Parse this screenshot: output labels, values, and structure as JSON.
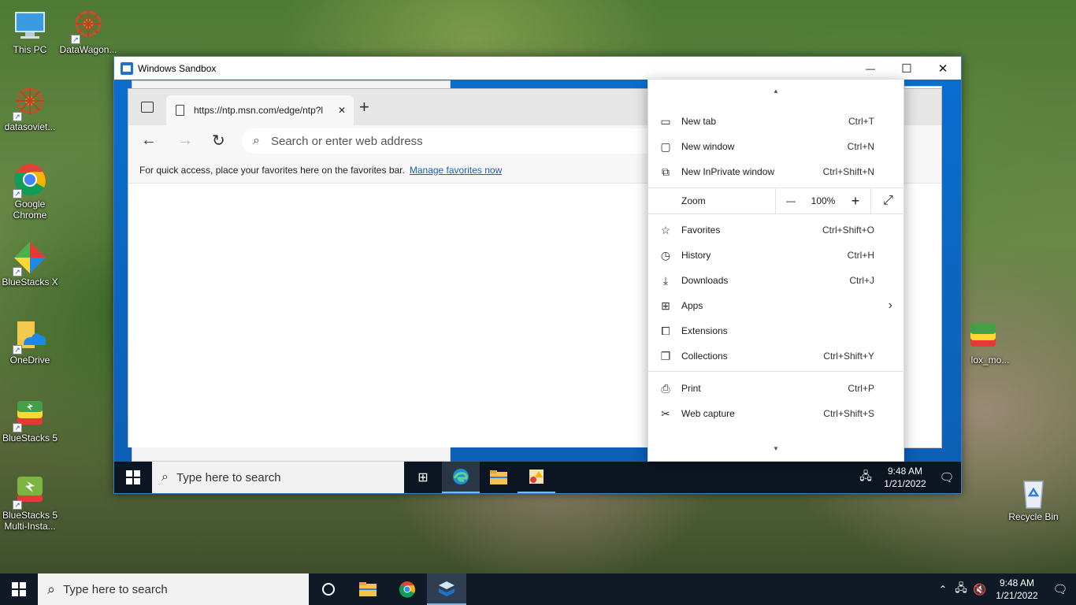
{
  "desktop": {
    "icons": [
      {
        "label": "This PC",
        "icon": "computer-icon"
      },
      {
        "label": "DataWagon...",
        "icon": "datawagon-icon"
      },
      {
        "label": "datasoviet...",
        "icon": "datasoviet-icon"
      },
      {
        "label": "Google Chrome",
        "icon": "chrome-icon"
      },
      {
        "label": "BlueStacks X",
        "icon": "bluestacks-x-icon"
      },
      {
        "label": "OneDrive",
        "icon": "onedrive-icon"
      },
      {
        "label": "BlueStacks 5",
        "icon": "bluestacks-icon"
      },
      {
        "label": "BlueStacks 5 Multi-Insta...",
        "icon": "bluestacks-multi-icon"
      },
      {
        "label": "Recycle Bin",
        "icon": "recycle-bin-icon"
      },
      {
        "label": "lox_mo...",
        "icon": "bluestacks-icon"
      }
    ]
  },
  "sandbox": {
    "title": "Windows Sandbox",
    "controls": {
      "minimize": "—",
      "maximize": "☐",
      "close": "✕"
    }
  },
  "edge": {
    "tab_title": "https://ntp.msn.com/edge/ntp?l",
    "new_tab_symbol": "+",
    "address_placeholder": "Search or enter web address",
    "favorites_hint": "For quick access, place your favorites here on the favorites bar.",
    "manage_favorites": "Manage favorites now",
    "more_button": "···",
    "close_x": "✕"
  },
  "menu": {
    "items": [
      {
        "label": "New tab",
        "shortcut": "Ctrl+T",
        "icon": "new-tab-icon"
      },
      {
        "label": "New window",
        "shortcut": "Ctrl+N",
        "icon": "new-window-icon"
      },
      {
        "label": "New InPrivate window",
        "shortcut": "Ctrl+Shift+N",
        "icon": "inprivate-icon"
      },
      {
        "label": "Favorites",
        "shortcut": "Ctrl+Shift+O",
        "icon": "favorites-icon"
      },
      {
        "label": "History",
        "shortcut": "Ctrl+H",
        "icon": "history-icon"
      },
      {
        "label": "Downloads",
        "shortcut": "Ctrl+J",
        "icon": "download-icon"
      },
      {
        "label": "Apps",
        "shortcut": "",
        "icon": "apps-icon"
      },
      {
        "label": "Extensions",
        "shortcut": "",
        "icon": "extensions-icon"
      },
      {
        "label": "Collections",
        "shortcut": "Ctrl+Shift+Y",
        "icon": "collections-icon"
      },
      {
        "label": "Print",
        "shortcut": "Ctrl+P",
        "icon": "print-icon"
      },
      {
        "label": "Web capture",
        "shortcut": "Ctrl+Shift+S",
        "icon": "web-capture-icon"
      }
    ],
    "zoom": {
      "label": "Zoom",
      "value": "100%",
      "minus": "—",
      "plus": "+"
    }
  },
  "inner_taskbar": {
    "search_placeholder": "Type here to search",
    "time": "9:48 AM",
    "date": "1/21/2022"
  },
  "taskbar": {
    "search_placeholder": "Type here to search",
    "time": "9:48 AM",
    "date": "1/21/2022"
  }
}
